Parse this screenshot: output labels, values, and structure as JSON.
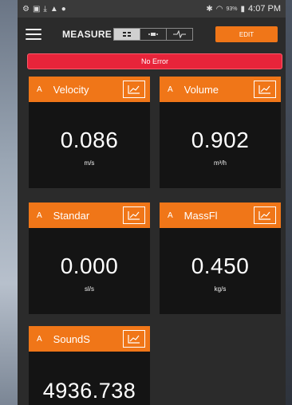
{
  "statusbar": {
    "left_icons": [
      "wifi-settings-icon",
      "gallery-icon",
      "download-icon",
      "alert-icon",
      "circle-icon"
    ],
    "battery_pct": "93%",
    "time": "4:07 PM"
  },
  "toolbar": {
    "title": "MEASURE",
    "edit_label": "EDIT",
    "view_tabs": [
      "grid",
      "dots",
      "waveform"
    ]
  },
  "error_bar": {
    "text": "No Error"
  },
  "tiles": [
    {
      "badge": "A",
      "name": "Velocity",
      "value": "0.086",
      "unit": "m/s"
    },
    {
      "badge": "A",
      "name": "Volume",
      "value": "0.902",
      "unit": "m³/h"
    },
    {
      "badge": "A",
      "name": "Standar",
      "value": "0.000",
      "unit": "sl/s"
    },
    {
      "badge": "A",
      "name": "MassFl",
      "value": "0.450",
      "unit": "kg/s"
    },
    {
      "badge": "A",
      "name": "SoundS",
      "value": "4936.738",
      "unit": ""
    }
  ],
  "colors": {
    "accent": "#f07618",
    "error": "#e8243a",
    "tile_bg": "#141414",
    "screen_bg": "#2b2b2b"
  }
}
